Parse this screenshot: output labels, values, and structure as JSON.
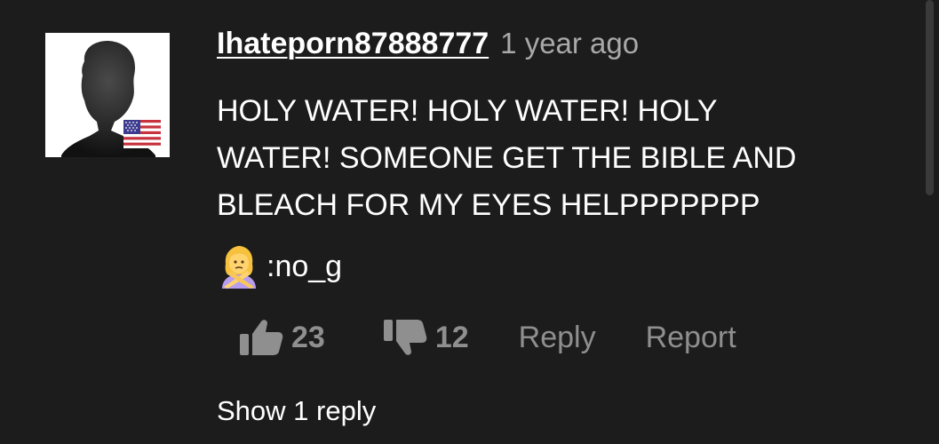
{
  "comment": {
    "username": "Ihateporn87888777",
    "timestamp": "1 year ago",
    "text_lines": [
      "HOLY WATER! HOLY WATER! HOLY",
      "WATER! SOMEONE GET THE BIBLE AND",
      "BLEACH FOR MY EYES HELPPPPPPP"
    ],
    "emoji_text": ":no_g",
    "emoji_icon": "person-gesturing-no-icon",
    "avatar_icon": "default-user-silhouette-icon",
    "flag_icon": "us-flag-icon"
  },
  "actions": {
    "likes": "23",
    "dislikes": "12",
    "reply_label": "Reply",
    "report_label": "Report"
  },
  "show_replies_label": "Show 1 reply",
  "colors": {
    "background": "#1c1c1c",
    "text_primary": "#ffffff",
    "text_secondary": "#8f8f8f",
    "timestamp": "#a9a9a9"
  }
}
